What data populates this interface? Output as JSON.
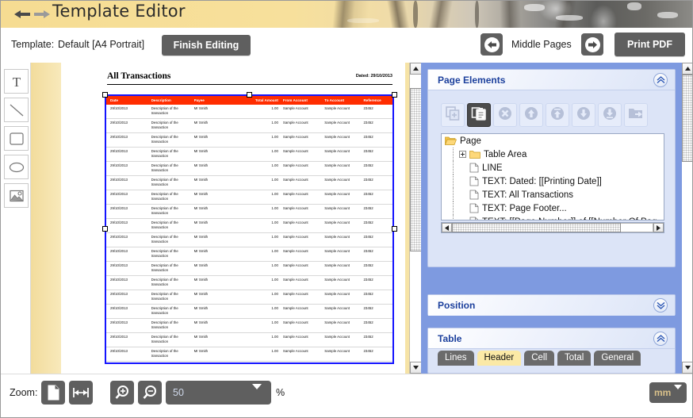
{
  "window": {
    "title": "Template Editor"
  },
  "header": {
    "back_icon": "arrow-left-icon",
    "forward_icon": "arrow-right-icon"
  },
  "toolbar": {
    "template_label": "Template:",
    "template_value": "Default [A4 Portrait]",
    "finish_editing_label": "Finish Editing",
    "page_nav_label": "Middle Pages",
    "prev_page_icon": "arrow-left-circle-icon",
    "next_page_icon": "arrow-right-circle-icon",
    "print_pdf_label": "Print PDF"
  },
  "tools": [
    {
      "name": "text-tool",
      "icon": "text-T-icon"
    },
    {
      "name": "line-tool",
      "icon": "diagonal-line-icon"
    },
    {
      "name": "rectangle-tool",
      "icon": "rectangle-icon"
    },
    {
      "name": "ellipse-tool",
      "icon": "ellipse-icon"
    },
    {
      "name": "image-tool",
      "icon": "picture-icon"
    }
  ],
  "document": {
    "title": "All Transactions",
    "date_text": "Dated: 29/10/2013",
    "table": {
      "headers": [
        "Date",
        "Description",
        "Payee",
        "Total Amount",
        "From Account",
        "To Account",
        "Reference"
      ],
      "rows": [
        [
          "29/10/2013",
          "Description of the transaction",
          "Mr Smith",
          "1.00",
          "Sample Account",
          "Sample Account",
          "23452"
        ],
        [
          "29/10/2013",
          "Description of the transaction",
          "Mr Smith",
          "1.00",
          "Sample Account",
          "Sample Account",
          "23452"
        ],
        [
          "29/10/2013",
          "Description of the transaction",
          "Mr Smith",
          "1.00",
          "Sample Account",
          "Sample Account",
          "23452"
        ],
        [
          "29/10/2013",
          "Description of the transaction",
          "Mr Smith",
          "1.00",
          "Sample Account",
          "Sample Account",
          "23452"
        ],
        [
          "29/10/2013",
          "Description of the transaction",
          "Mr Smith",
          "1.00",
          "Sample Account",
          "Sample Account",
          "23452"
        ],
        [
          "29/10/2013",
          "Description of the transaction",
          "Mr Smith",
          "1.00",
          "Sample Account",
          "Sample Account",
          "23452"
        ],
        [
          "29/10/2013",
          "Description of the transaction",
          "Mr Smith",
          "1.00",
          "Sample Account",
          "Sample Account",
          "23452"
        ],
        [
          "29/10/2013",
          "Description of the transaction",
          "Mr Smith",
          "1.00",
          "Sample Account",
          "Sample Account",
          "23452"
        ],
        [
          "29/10/2013",
          "Description of the transaction",
          "Mr Smith",
          "1.00",
          "Sample Account",
          "Sample Account",
          "23452"
        ],
        [
          "29/10/2013",
          "Description of the transaction",
          "Mr Smith",
          "1.00",
          "Sample Account",
          "Sample Account",
          "23452"
        ],
        [
          "29/10/2013",
          "Description of the transaction",
          "Mr Smith",
          "1.00",
          "Sample Account",
          "Sample Account",
          "23452"
        ],
        [
          "29/10/2013",
          "Description of the transaction",
          "Mr Smith",
          "1.00",
          "Sample Account",
          "Sample Account",
          "23452"
        ],
        [
          "29/10/2013",
          "Description of the transaction",
          "Mr Smith",
          "1.00",
          "Sample Account",
          "Sample Account",
          "23452"
        ],
        [
          "29/10/2013",
          "Description of the transaction",
          "Mr Smith",
          "1.00",
          "Sample Account",
          "Sample Account",
          "23452"
        ],
        [
          "29/10/2013",
          "Description of the transaction",
          "Mr Smith",
          "1.00",
          "Sample Account",
          "Sample Account",
          "23452"
        ],
        [
          "29/10/2013",
          "Description of the transaction",
          "Mr Smith",
          "1.00",
          "Sample Account",
          "Sample Account",
          "23452"
        ],
        [
          "29/10/2013",
          "Description of the transaction",
          "Mr Smith",
          "1.00",
          "Sample Account",
          "Sample Account",
          "23452"
        ],
        [
          "29/10/2013",
          "Description of the transaction",
          "Mr Smith",
          "1.00",
          "Sample Account",
          "Sample Account",
          "23452"
        ]
      ]
    },
    "header_color": "#ff2d00",
    "selection_color": "#1414ff"
  },
  "panels": {
    "page_elements": {
      "title": "Page Elements",
      "collapse_icon": "chevron-up-icon",
      "buttons": [
        {
          "name": "add-element-button",
          "icon": "copy-add-icon",
          "selected": false
        },
        {
          "name": "duplicate-button",
          "icon": "clipboard-paste-icon",
          "selected": true
        },
        {
          "name": "delete-element-button",
          "icon": "delete-x-icon",
          "selected": false
        },
        {
          "name": "move-up-button",
          "icon": "arrow-up-icon",
          "selected": false
        },
        {
          "name": "move-to-top-button",
          "icon": "arrow-up-bar-icon",
          "selected": false
        },
        {
          "name": "move-down-button",
          "icon": "arrow-down-icon",
          "selected": false
        },
        {
          "name": "move-to-bottom-button",
          "icon": "arrow-down-bar-icon",
          "selected": false
        },
        {
          "name": "group-button",
          "icon": "folder-in-icon",
          "selected": false
        }
      ],
      "tree": [
        {
          "label": "Page",
          "icon": "open-folder-icon",
          "indent": 0,
          "expander": "none"
        },
        {
          "label": "Table Area",
          "icon": "folder-icon",
          "indent": 1,
          "expander": "plus"
        },
        {
          "label": "LINE",
          "icon": "document-page-icon",
          "indent": 1,
          "expander": "none"
        },
        {
          "label": "TEXT: Dated: [[Printing Date]]",
          "icon": "document-page-icon",
          "indent": 1,
          "expander": "none"
        },
        {
          "label": "TEXT: All Transactions",
          "icon": "document-page-icon",
          "indent": 1,
          "expander": "none"
        },
        {
          "label": "TEXT: Page Footer...",
          "icon": "document-page-icon",
          "indent": 1,
          "expander": "none"
        },
        {
          "label": "TEXT: [[Page Number]] of [[Number Of Pag",
          "icon": "document-page-icon",
          "indent": 1,
          "expander": "none"
        }
      ]
    },
    "position": {
      "title": "Position",
      "expand_icon": "chevron-down-icon"
    },
    "table": {
      "title": "Table",
      "collapse_icon": "chevron-up-icon",
      "tabs": [
        {
          "label": "Lines",
          "active": false
        },
        {
          "label": "Header",
          "active": true
        },
        {
          "label": "Cell",
          "active": false
        },
        {
          "label": "Total",
          "active": false
        },
        {
          "label": "General",
          "active": false
        }
      ]
    }
  },
  "statusbar": {
    "zoom_label": "Zoom:",
    "fit_page_icon": "page-icon",
    "fit_width_icon": "fit-width-icon",
    "zoom_in_icon": "magnifier-plus-icon",
    "zoom_out_icon": "magnifier-minus-icon",
    "zoom_value": "50",
    "percent_label": "%",
    "units_value": "mm",
    "dropdown_icon": "caret-down-icon"
  },
  "colors": {
    "banner": "#f6dc92",
    "panel_blue": "#7e9ae0",
    "group_bg": "#dce4f7",
    "group_title": "#1b3f9c",
    "dark_button": "#5f5f5f",
    "canvas_yellow": "#f6e3a6",
    "tab_active": "#fbe9a6"
  }
}
